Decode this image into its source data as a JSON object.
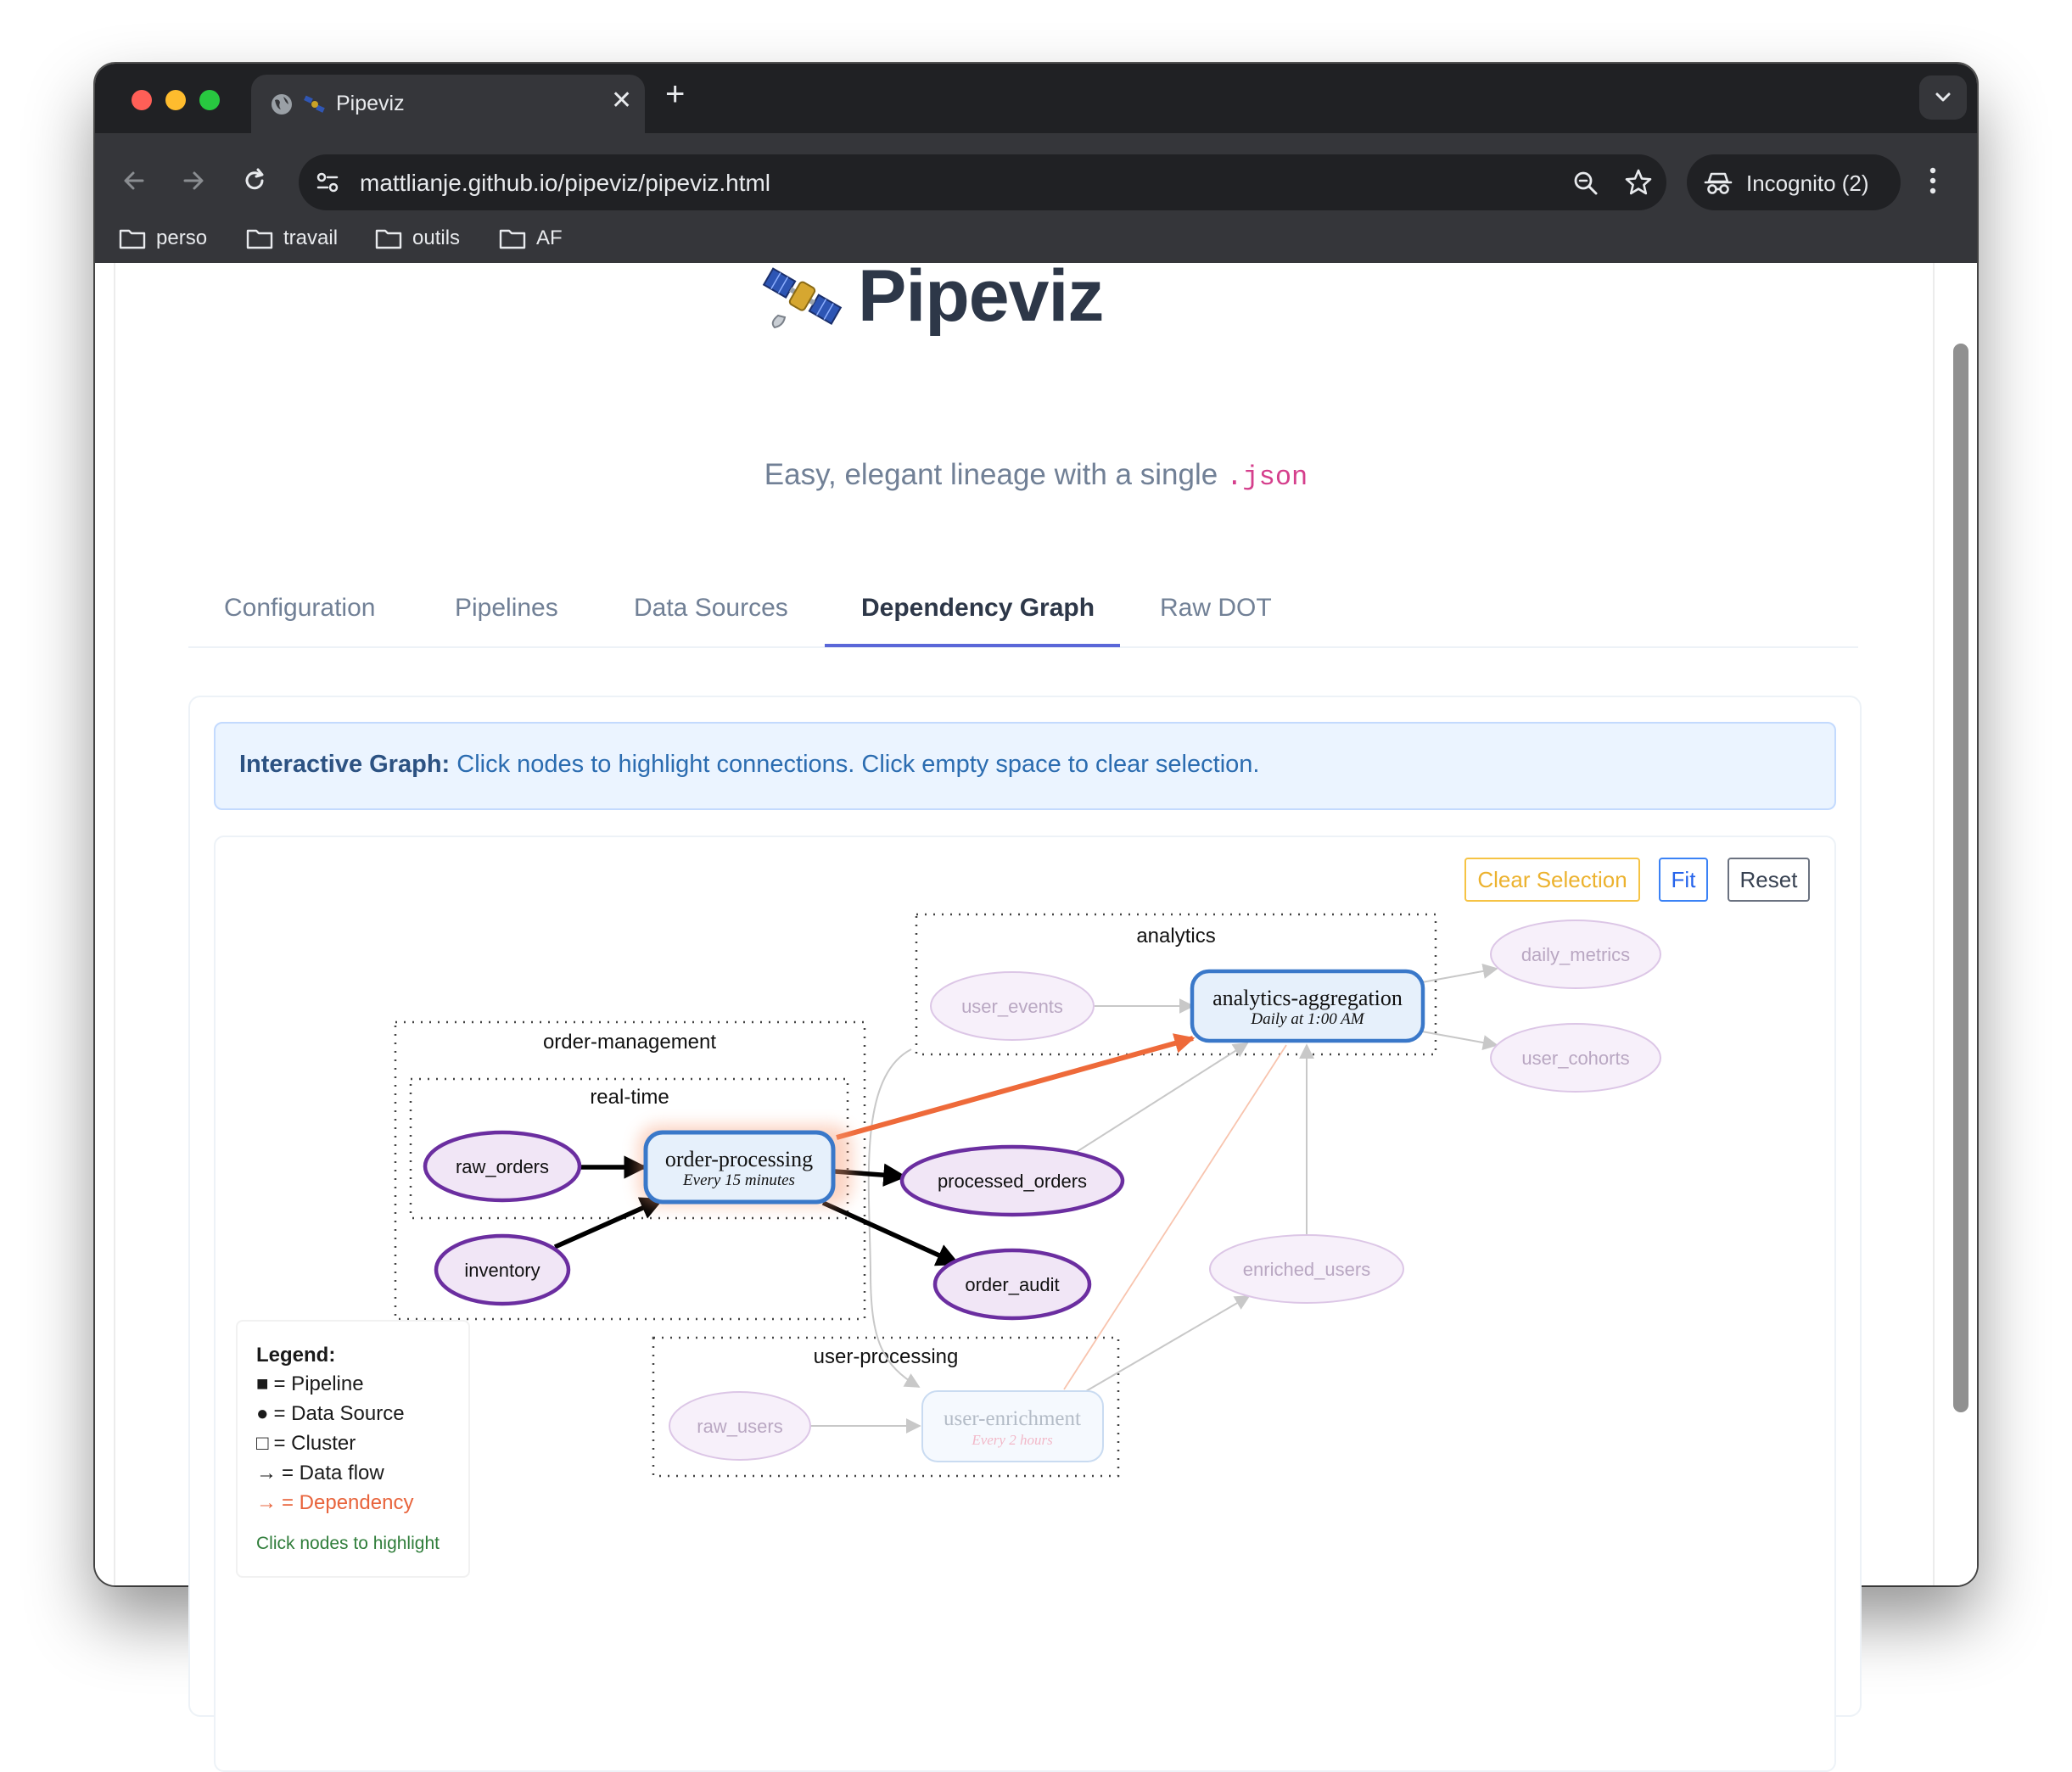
{
  "browser": {
    "tab_title": "Pipeviz",
    "tab_close": "✕",
    "new_tab": "+",
    "url": "mattlianje.github.io/pipeviz/pipeviz.html",
    "incognito_label": "Incognito (2)",
    "bookmarks": [
      {
        "label": "perso"
      },
      {
        "label": "travail"
      },
      {
        "label": "outils"
      },
      {
        "label": "AF"
      }
    ]
  },
  "page": {
    "title": "Pipeviz",
    "subtitle": "Easy, elegant lineage with a single",
    "subtitle_code": ".json",
    "tabs": [
      {
        "label": "Configuration"
      },
      {
        "label": "Pipelines"
      },
      {
        "label": "Data Sources"
      },
      {
        "label": "Dependency Graph"
      },
      {
        "label": "Raw DOT"
      }
    ],
    "active_tab": "Dependency Graph",
    "info_bold": "Interactive Graph:",
    "info_text": "Click nodes to highlight connections. Click empty space to clear selection.",
    "buttons": {
      "clear": "Clear Selection",
      "fit": "Fit",
      "reset": "Reset"
    }
  },
  "graph": {
    "clusters": {
      "order_management": "order-management",
      "real_time": "real-time",
      "analytics": "analytics",
      "user_processing": "user-processing"
    },
    "pipelines": {
      "order_processing": {
        "name": "order-processing",
        "schedule": "Every 15 minutes"
      },
      "analytics_aggregation": {
        "name": "analytics-aggregation",
        "schedule": "Daily at 1:00 AM"
      },
      "user_enrichment": {
        "name": "user-enrichment",
        "schedule": "Every 2 hours"
      }
    },
    "sources": {
      "raw_orders": "raw_orders",
      "inventory": "inventory",
      "processed_orders": "processed_orders",
      "order_audit": "order_audit",
      "user_events": "user_events",
      "daily_metrics": "daily_metrics",
      "user_cohorts": "user_cohorts",
      "enriched_users": "enriched_users",
      "raw_users": "raw_users"
    },
    "colors": {
      "pipeline_fill": "#e6f0fb",
      "pipeline_border": "#3a78c9",
      "source_fill": "#f1e6f6",
      "source_border": "#6b2ea0",
      "dependency": "#ee6a3a"
    }
  },
  "legend": {
    "title": "Legend:",
    "items": [
      {
        "symbol": "■",
        "label": "= Pipeline"
      },
      {
        "symbol": "●",
        "label": "= Data Source"
      },
      {
        "symbol": "□",
        "label": "= Cluster"
      },
      {
        "symbol": "→",
        "label": "= Data flow"
      },
      {
        "symbol": "→",
        "label": "= Dependency"
      }
    ],
    "footer": "Click nodes to highlight"
  }
}
